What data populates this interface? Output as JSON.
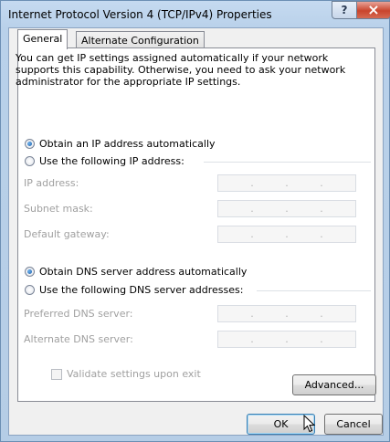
{
  "window": {
    "title": "Internet Protocol Version 4 (TCP/IPv4) Properties",
    "help_icon": "?",
    "close_icon": "×"
  },
  "tabs": [
    {
      "label": "General",
      "active": true
    },
    {
      "label": "Alternate Configuration",
      "active": false
    }
  ],
  "description": "You can get IP settings assigned automatically if your network supports this capability. Otherwise, you need to ask your network administrator for the appropriate IP settings.",
  "ip_section": {
    "auto_label": "Obtain an IP address automatically",
    "auto_selected": true,
    "manual_label": "Use the following IP address:",
    "fields": [
      {
        "label": "IP address:",
        "value": ". . ."
      },
      {
        "label": "Subnet mask:",
        "value": ". . ."
      },
      {
        "label": "Default gateway:",
        "value": ". . ."
      }
    ]
  },
  "dns_section": {
    "auto_label": "Obtain DNS server address automatically",
    "auto_selected": true,
    "manual_label": "Use the following DNS server addresses:",
    "fields": [
      {
        "label": "Preferred DNS server:",
        "value": ". . ."
      },
      {
        "label": "Alternate DNS server:",
        "value": ". . ."
      }
    ]
  },
  "validate_label": "Validate settings upon exit",
  "validate_checked": false,
  "buttons": {
    "advanced": "Advanced...",
    "ok": "OK",
    "cancel": "Cancel"
  },
  "colors": {
    "title_bar": "#b9d1ea",
    "close_button": "#c9442c",
    "radio_dot": "#1b5ea8"
  }
}
